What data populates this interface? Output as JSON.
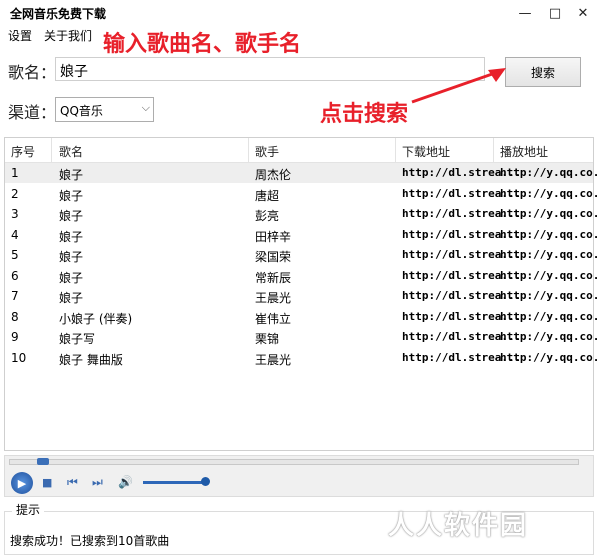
{
  "window": {
    "title": "全网音乐免费下载",
    "min": "—",
    "max": "□",
    "close": "✕"
  },
  "menu": {
    "settings": "设置",
    "about": "关于我们"
  },
  "annotations": {
    "top": "输入歌曲名、歌手名",
    "search": "点击搜索"
  },
  "form": {
    "song_label": "歌名：",
    "song_value": "娘子",
    "search_button": "搜索",
    "channel_label": "渠道：",
    "channel_value": "QQ音乐"
  },
  "table": {
    "headers": [
      "序号",
      "歌名",
      "歌手",
      "下载地址",
      "播放地址"
    ],
    "rows": [
      [
        "1",
        "娘子",
        "周杰伦",
        "http://dl.strea...",
        "http://y.qq.co..."
      ],
      [
        "2",
        "娘子",
        "唐超",
        "http://dl.strea...",
        "http://y.qq.co..."
      ],
      [
        "3",
        "娘子",
        "彭亮",
        "http://dl.strea...",
        "http://y.qq.co..."
      ],
      [
        "4",
        "娘子",
        "田梓辛",
        "http://dl.strea...",
        "http://y.qq.co..."
      ],
      [
        "5",
        "娘子",
        "梁国荣",
        "http://dl.strea...",
        "http://y.qq.co..."
      ],
      [
        "6",
        "娘子",
        "常新辰",
        "http://dl.strea...",
        "http://y.qq.co..."
      ],
      [
        "7",
        "娘子",
        "王晨光",
        "http://dl.strea...",
        "http://y.qq.co..."
      ],
      [
        "8",
        "小娘子 (伴奏)",
        "崔伟立",
        "http://dl.strea...",
        "http://y.qq.co..."
      ],
      [
        "9",
        "娘子写",
        "栗锦",
        "http://dl.strea...",
        "http://y.qq.co..."
      ],
      [
        "10",
        "娘子 舞曲版",
        "王晨光",
        "http://dl.strea...",
        "http://y.qq.co..."
      ]
    ]
  },
  "player": {
    "icons": [
      "play-icon",
      "stop-icon",
      "previous-icon",
      "next-icon",
      "volume-icon"
    ],
    "accent": "#2d67b8",
    "volume": 0.95
  },
  "tips": {
    "label": "提示",
    "message": "搜索成功！已搜索到10首歌曲"
  },
  "watermark": "人人软件园"
}
